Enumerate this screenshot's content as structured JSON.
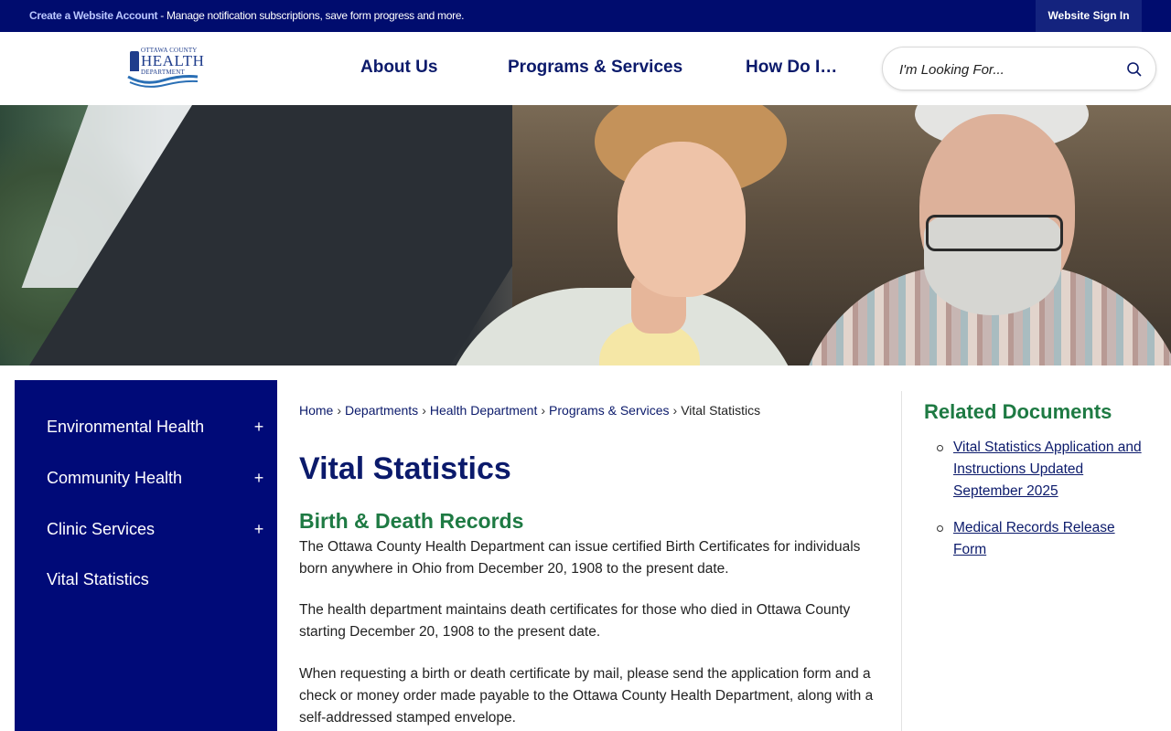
{
  "topbar": {
    "account_link": "Create a Website Account",
    "account_message": " - Manage notification subscriptions, save form progress and more.",
    "signin_label": "Website Sign In"
  },
  "header": {
    "logo": {
      "line1": "OTTAWA COUNTY",
      "line2": "HEALTH",
      "line3": "DEPARTMENT"
    },
    "nav": [
      {
        "label": "About Us"
      },
      {
        "label": "Programs & Services"
      },
      {
        "label": "How Do I…"
      }
    ],
    "search": {
      "placeholder": "I'm Looking For...",
      "icon": "search-icon"
    }
  },
  "sidebar": {
    "items": [
      {
        "label": "Environmental Health",
        "expand": "+"
      },
      {
        "label": "Community Health",
        "expand": "+"
      },
      {
        "label": "Clinic Services",
        "expand": "+"
      },
      {
        "label": "Vital Statistics"
      }
    ]
  },
  "main": {
    "breadcrumb": [
      {
        "label": "Home"
      },
      {
        "label": "Departments"
      },
      {
        "label": "Health Department"
      },
      {
        "label": "Programs & Services"
      },
      {
        "label": "Vital Statistics"
      }
    ],
    "breadcrumb_separator": "›",
    "title": "Vital Statistics",
    "section_title": "Birth & Death Records",
    "paragraphs": [
      "The Ottawa County Health Department can issue certified Birth Certificates for individuals born anywhere in Ohio from December 20, 1908 to the present date.",
      "The health department maintains death certificates for those who died in Ottawa County starting December 20, 1908 to the present date.",
      "When requesting a birth or death certificate by mail, please send the application form and a check or money order made payable to the Ottawa County Health Department, along with a self-addressed stamped envelope."
    ]
  },
  "related": {
    "title": "Related Documents",
    "documents": [
      {
        "label": "Vital Statistics Application and Instructions Updated September 2025"
      },
      {
        "label": "Medical Records Release Form"
      }
    ]
  },
  "colors": {
    "brand_navy": "#000c6e",
    "sidebar_bg": "#000a78",
    "heading_navy": "#0b1a6b",
    "heading_green": "#1e7a43"
  }
}
